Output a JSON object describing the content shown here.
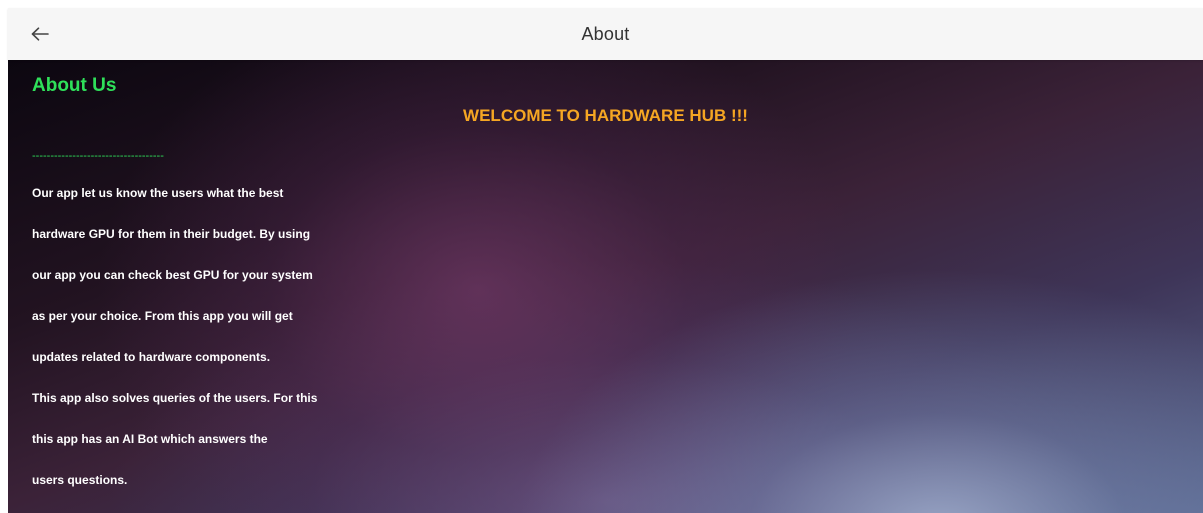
{
  "appbar": {
    "title": "About",
    "back_icon": "arrow-back-icon"
  },
  "content": {
    "about_heading": "About Us",
    "welcome_heading": "WELCOME TO HARDWARE HUB !!!",
    "divider": "------------------------------------",
    "body_lines": [
      "Our app let us know the users what the best",
      "hardware GPU for them in their budget. By using",
      "our app you can check best GPU for your system",
      "as per your choice. From this app you will get",
      "updates related to hardware components.",
      "This app also solves queries of the users. For this",
      "this app has an AI Bot which answers the",
      "users questions."
    ]
  },
  "colors": {
    "about_heading": "#2fe05a",
    "welcome_heading": "#f5a623",
    "body_text": "#ffffff",
    "appbar_bg": "#f6f6f6"
  }
}
